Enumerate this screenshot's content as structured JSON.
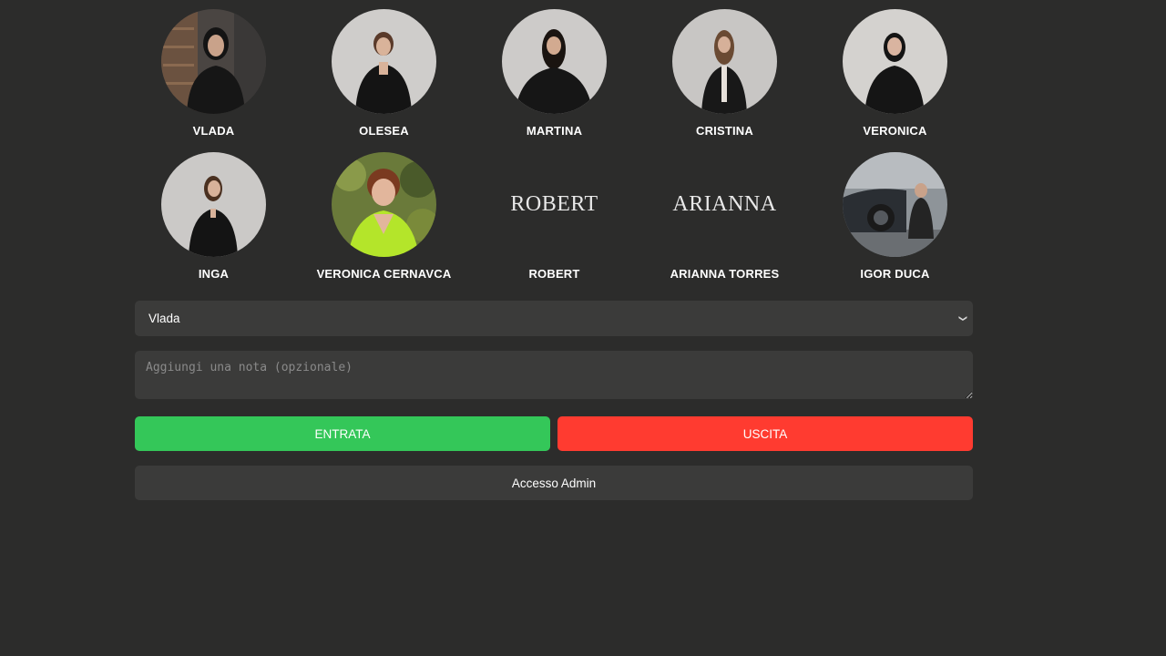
{
  "people": [
    {
      "name": "VLADA",
      "avatar": "photo"
    },
    {
      "name": "OLESEA",
      "avatar": "photo"
    },
    {
      "name": "MARTINA",
      "avatar": "photo"
    },
    {
      "name": "CRISTINA",
      "avatar": "photo"
    },
    {
      "name": "VERONICA",
      "avatar": "photo"
    },
    {
      "name": "INGA",
      "avatar": "photo"
    },
    {
      "name": "VERONICA CERNAVCA",
      "avatar": "photo"
    },
    {
      "name": "ROBERT",
      "avatar": "text",
      "avatar_text": "ROBERT"
    },
    {
      "name": "ARIANNA TORRES",
      "avatar": "text",
      "avatar_text": "ARIANNA"
    },
    {
      "name": "IGOR DUCA",
      "avatar": "photo"
    }
  ],
  "form": {
    "selected_employee": "Vlada",
    "note_placeholder": "Aggiungi una nota (opzionale)",
    "note_value": ""
  },
  "buttons": {
    "checkin_label": "ENTRATA",
    "checkout_label": "USCITA",
    "admin_label": "Accesso Admin"
  },
  "colors": {
    "background": "#2c2c2b",
    "field": "#3b3b3a",
    "checkin": "#34c759",
    "checkout": "#ff3b30"
  }
}
